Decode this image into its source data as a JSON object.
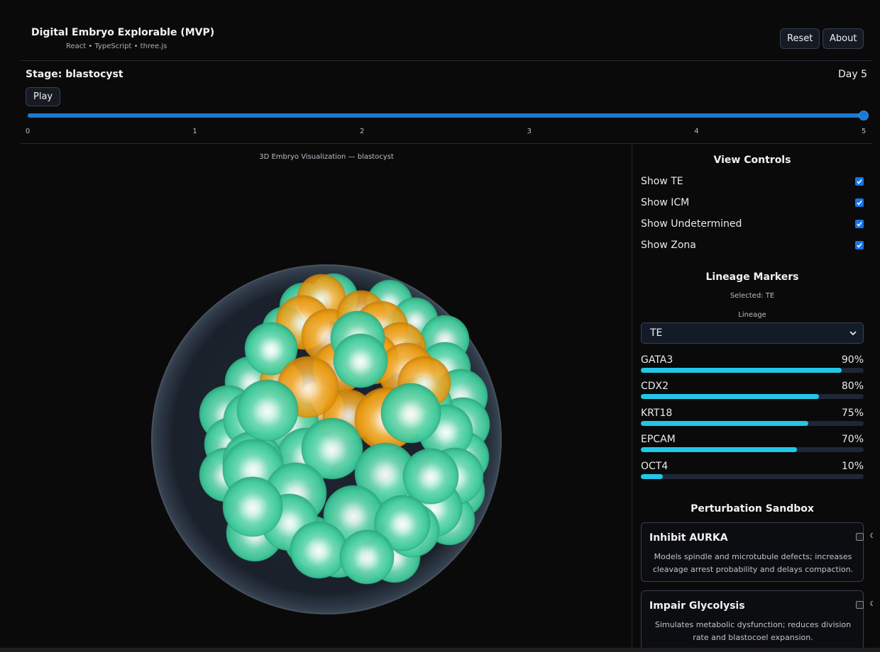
{
  "header": {
    "title": "Digital Embryo Explorable (MVP)",
    "subtitle": "React • TypeScript • three.js",
    "reset_label": "Reset",
    "about_label": "About"
  },
  "stage": {
    "label": "Stage: blastocyst",
    "day_label": "Day 5",
    "play_label": "Play",
    "slider": {
      "min": 0,
      "max": 5,
      "value": 5
    },
    "ticks": [
      "0",
      "1",
      "2",
      "3",
      "4",
      "5"
    ]
  },
  "viz": {
    "caption": "3D Embryo Visualization — blastocyst"
  },
  "view_controls": {
    "title": "View Controls",
    "toggles": [
      {
        "label": "Show TE",
        "checked": true
      },
      {
        "label": "Show ICM",
        "checked": true
      },
      {
        "label": "Show Undetermined",
        "checked": true
      },
      {
        "label": "Show Zona",
        "checked": true
      }
    ]
  },
  "lineage": {
    "title": "Lineage Markers",
    "selected_text": "Selected: TE",
    "select_label": "Lineage",
    "select_value": "TE",
    "markers": [
      {
        "name": "GATA3",
        "pct_label": "90%",
        "value": 0.9
      },
      {
        "name": "CDX2",
        "pct_label": "80%",
        "value": 0.8
      },
      {
        "name": "KRT18",
        "pct_label": "75%",
        "value": 0.75
      },
      {
        "name": "EPCAM",
        "pct_label": "70%",
        "value": 0.7
      },
      {
        "name": "OCT4",
        "pct_label": "10%",
        "value": 0.1
      }
    ]
  },
  "perturbation": {
    "title": "Perturbation Sandbox",
    "cards": [
      {
        "title": "Inhibit AURKA",
        "state": "Off",
        "description": "Models spindle and microtubule defects; increases cleavage arrest probability and delays compaction."
      },
      {
        "title": "Impair Glycolysis",
        "state": "Off",
        "description": "Simulates metabolic dysfunction; reduces division rate and blastocoel expansion."
      }
    ]
  },
  "colors": {
    "te_cell": "#3ec99a",
    "icm_cell": "#e8980f",
    "accent": "#1a7ad4",
    "marker_bar": "#22c6e6"
  }
}
